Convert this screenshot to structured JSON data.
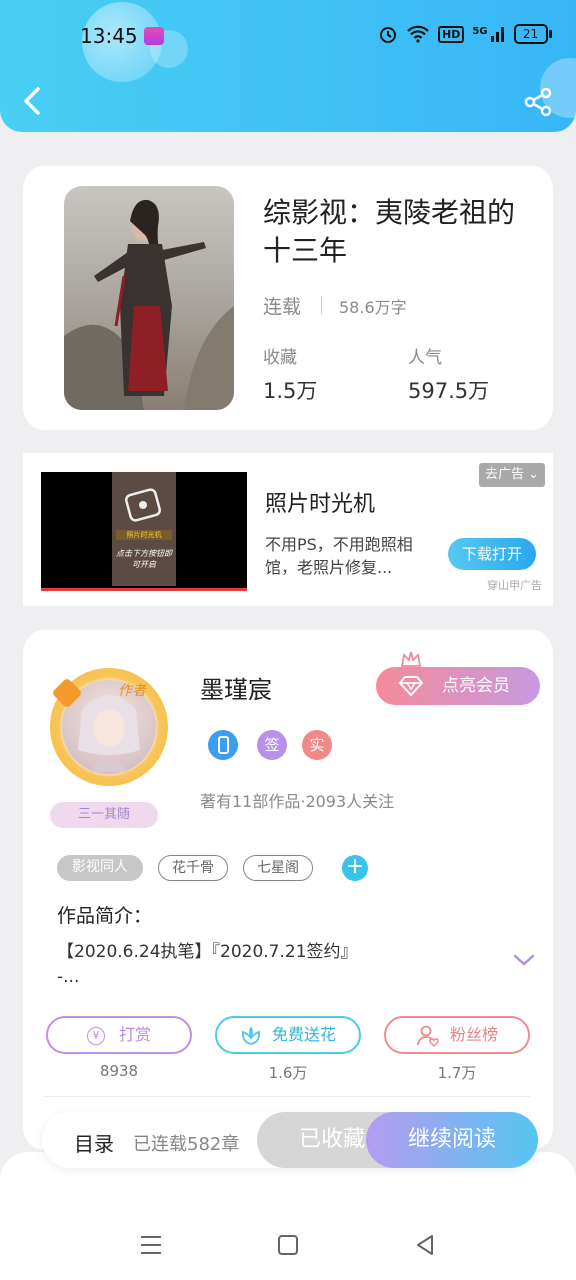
{
  "status_bar": {
    "time": "13:45",
    "hd": "HD",
    "signal": "5G",
    "battery": "21"
  },
  "book": {
    "title": "综影视：夷陵老祖的十三年",
    "status": "连载",
    "words": "58.6万字",
    "stats": [
      {
        "label": "收藏",
        "value": "1.5万"
      },
      {
        "label": "人气",
        "value": "597.5万"
      }
    ]
  },
  "ad": {
    "title": "照片时光机",
    "description": "不用PS，不用跑照相馆，老照片修复...",
    "close_label": "去广告",
    "download_label": "下载打开",
    "source": "穿山甲广告",
    "image_text_1": "照片时光机",
    "image_text_2": "点击下方按钮即可开启"
  },
  "author": {
    "name": "墨瑾宸",
    "crown_label": "作者",
    "avatar_tag": "三一其随",
    "vip_label": "点亮会员",
    "badges": [
      {
        "label": "",
        "color": "#3b9ef0"
      },
      {
        "label": "签",
        "color": "#b892e8"
      },
      {
        "label": "实",
        "color": "#f08a8a"
      }
    ],
    "meta": "著有11部作品·2093人关注",
    "tags": [
      "影视同人",
      "花千骨",
      "七星阁"
    ],
    "tag_add": "+",
    "intro_label": "作品简介：",
    "intro_text": "【2020.6.24执笔】『2020.7.21签约』\n-...",
    "actions": [
      {
        "label": "打赏",
        "value": "8938",
        "color": "#c48ee6"
      },
      {
        "label": "免费送花",
        "value": "1.6万",
        "color": "#4ccbe6"
      },
      {
        "label": "粉丝榜",
        "value": "1.7万",
        "color": "#ef8c8c"
      }
    ]
  },
  "bottom_bar": {
    "toc_label": "目录",
    "chapters": "已连载582章",
    "collected_label": "已收藏",
    "read_label": "继续阅读"
  }
}
